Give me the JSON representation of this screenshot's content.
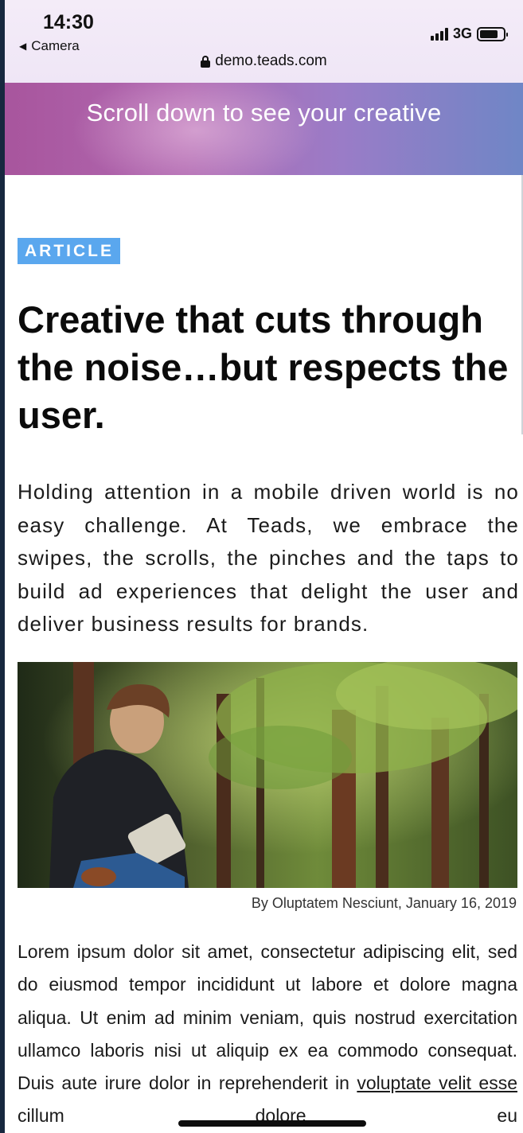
{
  "status_bar": {
    "time": "14:30",
    "back_app": "Camera",
    "network": "3G",
    "battery_level": 0.75,
    "signal_bars": 4
  },
  "browser": {
    "url": "demo.teads.com"
  },
  "banner": {
    "text": "Scroll down to see your creative"
  },
  "article": {
    "badge": "ARTICLE",
    "title": "Creative that cuts through the noise…but respects the user.",
    "lead": "Holding attention in a mobile driven world is no easy challenge. At Teads, we embrace the swipes, the scrolls, the pinches and the taps to build ad experiences that delight the user and deliver business results for brands.",
    "image_caption": "By Oluptatem Nesciunt, January 16, 2019",
    "body_before_link": "Lorem ipsum dolor sit amet, consectetur adipiscing elit, sed do eiusmod tempor incididunt ut labore et dolore magna aliqua. Ut enim ad minim veniam, quis nostrud exercitation ullamco laboris nisi ut aliquip ex ea commodo consequat. Duis aute irure dolor in reprehenderit in ",
    "body_link": "voluptate velit esse",
    "body_after_link": " cillum dolore eu"
  },
  "icons": {
    "lock": "lock-icon",
    "back": "back-triangle-icon",
    "signal": "signal-icon",
    "battery": "battery-icon"
  }
}
